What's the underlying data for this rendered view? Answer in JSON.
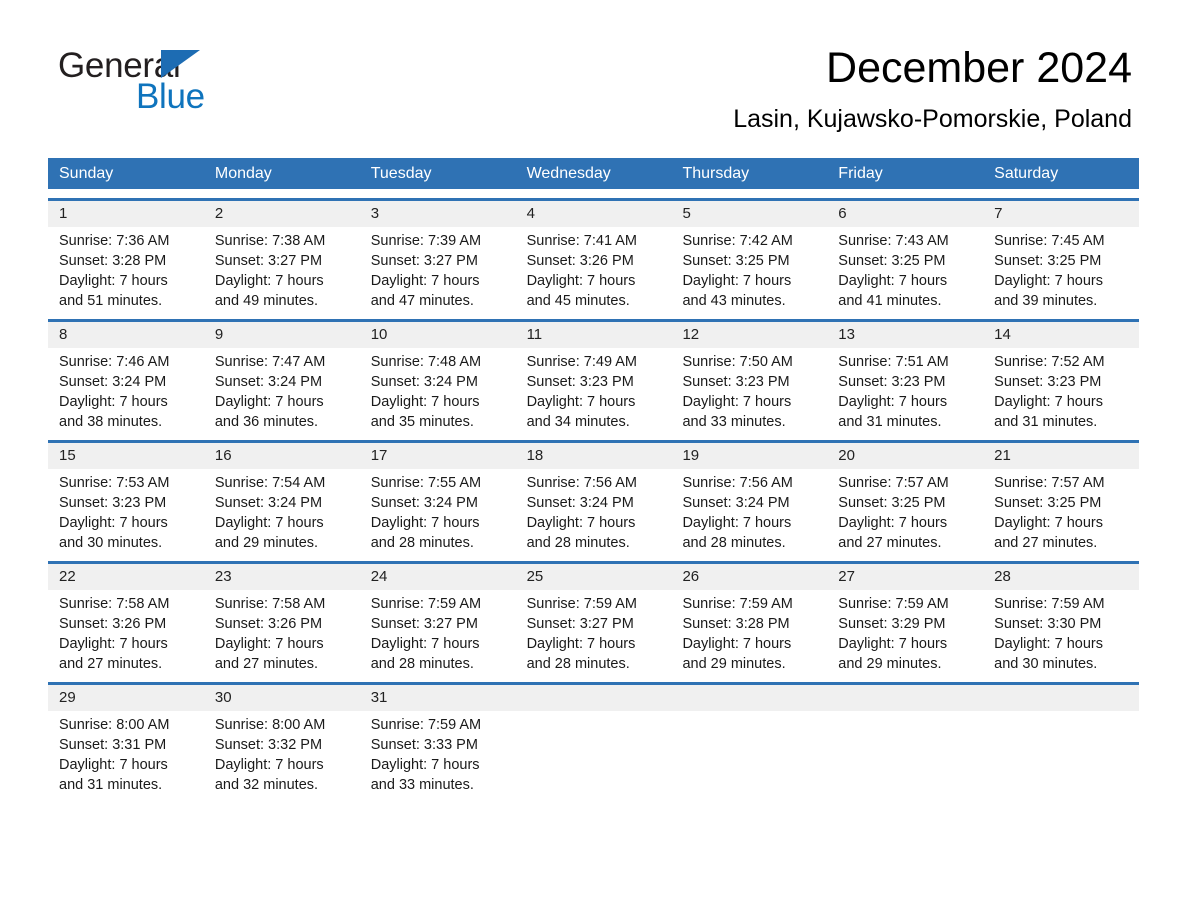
{
  "brand": {
    "name_part1": "General",
    "name_part2": "Blue",
    "accent_color": "#0f74bd",
    "triangle_color": "#1d6cb3"
  },
  "header": {
    "title": "December 2024",
    "subtitle": "Lasin, Kujawsko-Pomorskie, Poland"
  },
  "calendar": {
    "header_background": "#2f72b4",
    "header_text_color": "#ffffff",
    "daynum_background": "#f0f0f0",
    "weekdays": [
      "Sunday",
      "Monday",
      "Tuesday",
      "Wednesday",
      "Thursday",
      "Friday",
      "Saturday"
    ],
    "weeks": [
      {
        "days": [
          {
            "num": "1",
            "sunrise": "Sunrise: 7:36 AM",
            "sunset": "Sunset: 3:28 PM",
            "daylight_line1": "Daylight: 7 hours",
            "daylight_line2": "and 51 minutes."
          },
          {
            "num": "2",
            "sunrise": "Sunrise: 7:38 AM",
            "sunset": "Sunset: 3:27 PM",
            "daylight_line1": "Daylight: 7 hours",
            "daylight_line2": "and 49 minutes."
          },
          {
            "num": "3",
            "sunrise": "Sunrise: 7:39 AM",
            "sunset": "Sunset: 3:27 PM",
            "daylight_line1": "Daylight: 7 hours",
            "daylight_line2": "and 47 minutes."
          },
          {
            "num": "4",
            "sunrise": "Sunrise: 7:41 AM",
            "sunset": "Sunset: 3:26 PM",
            "daylight_line1": "Daylight: 7 hours",
            "daylight_line2": "and 45 minutes."
          },
          {
            "num": "5",
            "sunrise": "Sunrise: 7:42 AM",
            "sunset": "Sunset: 3:25 PM",
            "daylight_line1": "Daylight: 7 hours",
            "daylight_line2": "and 43 minutes."
          },
          {
            "num": "6",
            "sunrise": "Sunrise: 7:43 AM",
            "sunset": "Sunset: 3:25 PM",
            "daylight_line1": "Daylight: 7 hours",
            "daylight_line2": "and 41 minutes."
          },
          {
            "num": "7",
            "sunrise": "Sunrise: 7:45 AM",
            "sunset": "Sunset: 3:25 PM",
            "daylight_line1": "Daylight: 7 hours",
            "daylight_line2": "and 39 minutes."
          }
        ]
      },
      {
        "days": [
          {
            "num": "8",
            "sunrise": "Sunrise: 7:46 AM",
            "sunset": "Sunset: 3:24 PM",
            "daylight_line1": "Daylight: 7 hours",
            "daylight_line2": "and 38 minutes."
          },
          {
            "num": "9",
            "sunrise": "Sunrise: 7:47 AM",
            "sunset": "Sunset: 3:24 PM",
            "daylight_line1": "Daylight: 7 hours",
            "daylight_line2": "and 36 minutes."
          },
          {
            "num": "10",
            "sunrise": "Sunrise: 7:48 AM",
            "sunset": "Sunset: 3:24 PM",
            "daylight_line1": "Daylight: 7 hours",
            "daylight_line2": "and 35 minutes."
          },
          {
            "num": "11",
            "sunrise": "Sunrise: 7:49 AM",
            "sunset": "Sunset: 3:23 PM",
            "daylight_line1": "Daylight: 7 hours",
            "daylight_line2": "and 34 minutes."
          },
          {
            "num": "12",
            "sunrise": "Sunrise: 7:50 AM",
            "sunset": "Sunset: 3:23 PM",
            "daylight_line1": "Daylight: 7 hours",
            "daylight_line2": "and 33 minutes."
          },
          {
            "num": "13",
            "sunrise": "Sunrise: 7:51 AM",
            "sunset": "Sunset: 3:23 PM",
            "daylight_line1": "Daylight: 7 hours",
            "daylight_line2": "and 31 minutes."
          },
          {
            "num": "14",
            "sunrise": "Sunrise: 7:52 AM",
            "sunset": "Sunset: 3:23 PM",
            "daylight_line1": "Daylight: 7 hours",
            "daylight_line2": "and 31 minutes."
          }
        ]
      },
      {
        "days": [
          {
            "num": "15",
            "sunrise": "Sunrise: 7:53 AM",
            "sunset": "Sunset: 3:23 PM",
            "daylight_line1": "Daylight: 7 hours",
            "daylight_line2": "and 30 minutes."
          },
          {
            "num": "16",
            "sunrise": "Sunrise: 7:54 AM",
            "sunset": "Sunset: 3:24 PM",
            "daylight_line1": "Daylight: 7 hours",
            "daylight_line2": "and 29 minutes."
          },
          {
            "num": "17",
            "sunrise": "Sunrise: 7:55 AM",
            "sunset": "Sunset: 3:24 PM",
            "daylight_line1": "Daylight: 7 hours",
            "daylight_line2": "and 28 minutes."
          },
          {
            "num": "18",
            "sunrise": "Sunrise: 7:56 AM",
            "sunset": "Sunset: 3:24 PM",
            "daylight_line1": "Daylight: 7 hours",
            "daylight_line2": "and 28 minutes."
          },
          {
            "num": "19",
            "sunrise": "Sunrise: 7:56 AM",
            "sunset": "Sunset: 3:24 PM",
            "daylight_line1": "Daylight: 7 hours",
            "daylight_line2": "and 28 minutes."
          },
          {
            "num": "20",
            "sunrise": "Sunrise: 7:57 AM",
            "sunset": "Sunset: 3:25 PM",
            "daylight_line1": "Daylight: 7 hours",
            "daylight_line2": "and 27 minutes."
          },
          {
            "num": "21",
            "sunrise": "Sunrise: 7:57 AM",
            "sunset": "Sunset: 3:25 PM",
            "daylight_line1": "Daylight: 7 hours",
            "daylight_line2": "and 27 minutes."
          }
        ]
      },
      {
        "days": [
          {
            "num": "22",
            "sunrise": "Sunrise: 7:58 AM",
            "sunset": "Sunset: 3:26 PM",
            "daylight_line1": "Daylight: 7 hours",
            "daylight_line2": "and 27 minutes."
          },
          {
            "num": "23",
            "sunrise": "Sunrise: 7:58 AM",
            "sunset": "Sunset: 3:26 PM",
            "daylight_line1": "Daylight: 7 hours",
            "daylight_line2": "and 27 minutes."
          },
          {
            "num": "24",
            "sunrise": "Sunrise: 7:59 AM",
            "sunset": "Sunset: 3:27 PM",
            "daylight_line1": "Daylight: 7 hours",
            "daylight_line2": "and 28 minutes."
          },
          {
            "num": "25",
            "sunrise": "Sunrise: 7:59 AM",
            "sunset": "Sunset: 3:27 PM",
            "daylight_line1": "Daylight: 7 hours",
            "daylight_line2": "and 28 minutes."
          },
          {
            "num": "26",
            "sunrise": "Sunrise: 7:59 AM",
            "sunset": "Sunset: 3:28 PM",
            "daylight_line1": "Daylight: 7 hours",
            "daylight_line2": "and 29 minutes."
          },
          {
            "num": "27",
            "sunrise": "Sunrise: 7:59 AM",
            "sunset": "Sunset: 3:29 PM",
            "daylight_line1": "Daylight: 7 hours",
            "daylight_line2": "and 29 minutes."
          },
          {
            "num": "28",
            "sunrise": "Sunrise: 7:59 AM",
            "sunset": "Sunset: 3:30 PM",
            "daylight_line1": "Daylight: 7 hours",
            "daylight_line2": "and 30 minutes."
          }
        ]
      },
      {
        "days": [
          {
            "num": "29",
            "sunrise": "Sunrise: 8:00 AM",
            "sunset": "Sunset: 3:31 PM",
            "daylight_line1": "Daylight: 7 hours",
            "daylight_line2": "and 31 minutes."
          },
          {
            "num": "30",
            "sunrise": "Sunrise: 8:00 AM",
            "sunset": "Sunset: 3:32 PM",
            "daylight_line1": "Daylight: 7 hours",
            "daylight_line2": "and 32 minutes."
          },
          {
            "num": "31",
            "sunrise": "Sunrise: 7:59 AM",
            "sunset": "Sunset: 3:33 PM",
            "daylight_line1": "Daylight: 7 hours",
            "daylight_line2": "and 33 minutes."
          },
          {
            "num": "",
            "sunrise": "",
            "sunset": "",
            "daylight_line1": "",
            "daylight_line2": ""
          },
          {
            "num": "",
            "sunrise": "",
            "sunset": "",
            "daylight_line1": "",
            "daylight_line2": ""
          },
          {
            "num": "",
            "sunrise": "",
            "sunset": "",
            "daylight_line1": "",
            "daylight_line2": ""
          },
          {
            "num": "",
            "sunrise": "",
            "sunset": "",
            "daylight_line1": "",
            "daylight_line2": ""
          }
        ]
      }
    ]
  }
}
